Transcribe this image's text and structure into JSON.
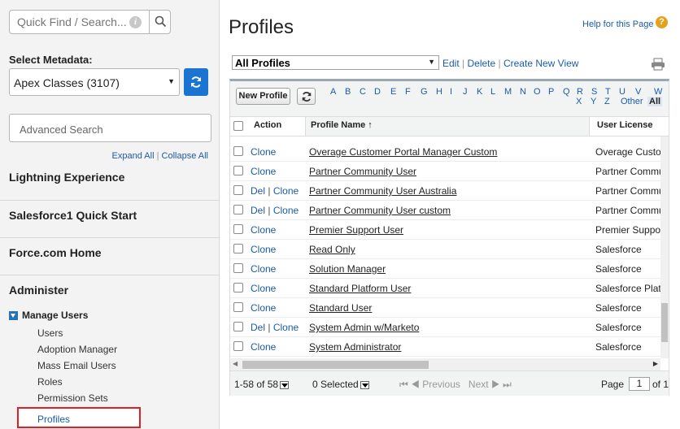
{
  "sidebar": {
    "search_placeholder": "Quick Find / Search...",
    "select_label": "Select Metadata:",
    "metadata_value": "Apex Classes (3107)",
    "advanced_search": "Advanced Search",
    "expand_all": "Expand All",
    "collapse_all": "Collapse All",
    "sections": [
      "Lightning Experience",
      "Salesforce1 Quick Start",
      "Force.com Home",
      "Administer"
    ],
    "manage_users": "Manage Users",
    "sub_items": [
      "Users",
      "Adoption Manager",
      "Mass Email Users",
      "Roles",
      "Permission Sets",
      "Profiles"
    ]
  },
  "main": {
    "title": "Profiles",
    "help": "Help for this Page",
    "view": "All Profiles",
    "edit": "Edit",
    "delete": "Delete",
    "create_view": "Create New View",
    "new_profile": "New Profile",
    "alphabet": [
      "A",
      "B",
      "C",
      "D",
      "E",
      "F",
      "G",
      "H",
      "I",
      "J",
      "K",
      "L",
      "M",
      "N",
      "O",
      "P",
      "Q",
      "R",
      "S",
      "T",
      "U",
      "V",
      "W",
      "X",
      "Y",
      "Z",
      "Other",
      "All"
    ],
    "columns": {
      "action": "Action",
      "name": "Profile Name ↑",
      "license": "User License"
    },
    "rows": [
      {
        "del": "",
        "clone": "Clone",
        "name": "Overage Customer Portal Manager Custom",
        "license": "Overage Customer"
      },
      {
        "del": "",
        "clone": "Clone",
        "name": "Partner Community User",
        "license": "Partner Community"
      },
      {
        "del": "Del",
        "clone": "Clone",
        "name": "Partner Community User Australia",
        "license": "Partner Community"
      },
      {
        "del": "Del",
        "clone": "Clone",
        "name": "Partner Community User custom",
        "license": "Partner Community"
      },
      {
        "del": "",
        "clone": "Clone",
        "name": "Premier Support User",
        "license": "Premier Support"
      },
      {
        "del": "",
        "clone": "Clone",
        "name": "Read Only",
        "license": "Salesforce"
      },
      {
        "del": "",
        "clone": "Clone",
        "name": "Solution Manager",
        "license": "Salesforce"
      },
      {
        "del": "",
        "clone": "Clone",
        "name": "Standard Platform User",
        "license": "Salesforce Platform"
      },
      {
        "del": "",
        "clone": "Clone",
        "name": "Standard User",
        "license": "Salesforce"
      },
      {
        "del": "Del",
        "clone": "Clone",
        "name": "System Admin w/Marketo",
        "license": "Salesforce"
      },
      {
        "del": "",
        "clone": "Clone",
        "name": "System Administrator",
        "license": "Salesforce"
      }
    ],
    "footer": {
      "range": "1-58 of 58",
      "selected": "0 Selected",
      "prev": "Previous",
      "next": "Next",
      "page_label": "Page",
      "page": "1",
      "of": "of 1"
    }
  }
}
